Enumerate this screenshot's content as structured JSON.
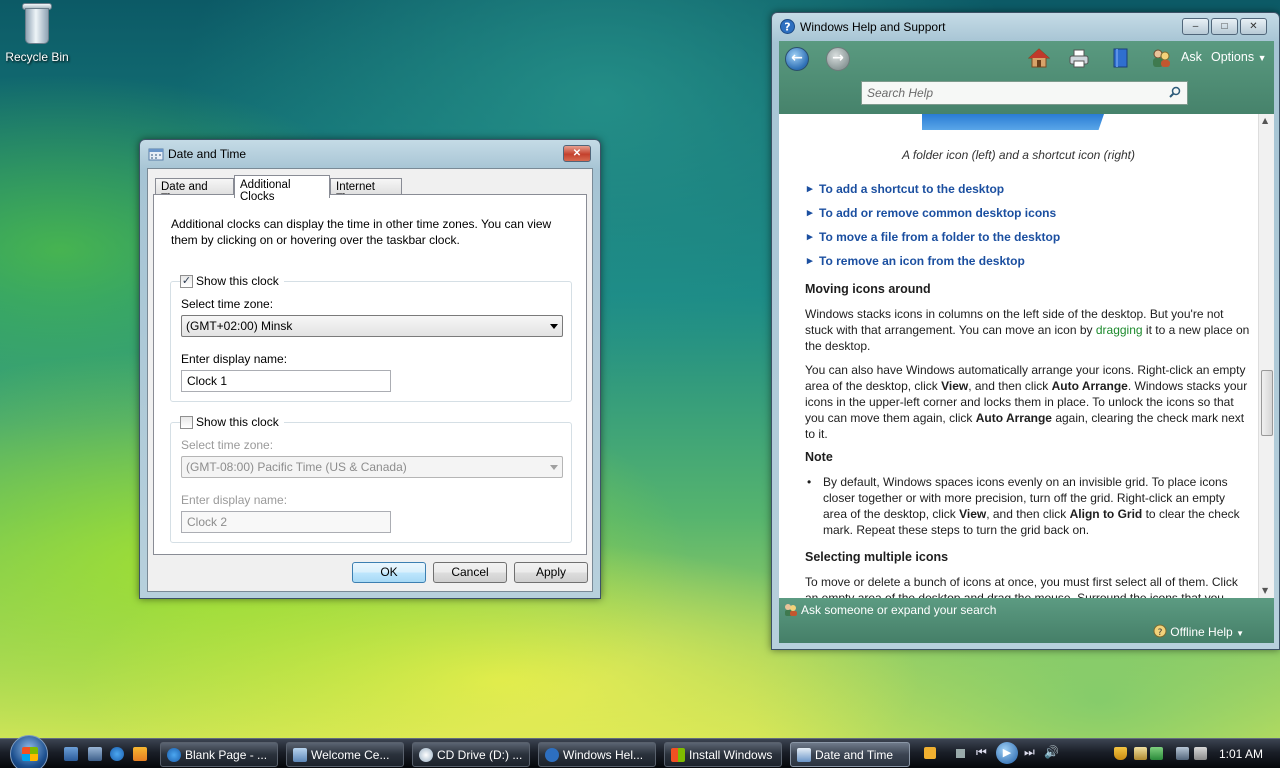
{
  "desktop": {
    "icons": [
      {
        "label": "Recycle Bin",
        "icon": "recycle-bin-icon"
      }
    ]
  },
  "date_time_dialog": {
    "title": "Date and Time",
    "tabs": [
      {
        "label": "Date and Time",
        "active": false
      },
      {
        "label": "Additional Clocks",
        "active": true
      },
      {
        "label": "Internet Time",
        "active": false
      }
    ],
    "description": "Additional clocks can display the time in other time zones. You can view them by clicking on or hovering over the taskbar clock.",
    "clock1": {
      "show_label": "Show this clock",
      "checked": true,
      "zone_label": "Select time zone:",
      "zone_value": "(GMT+02:00) Minsk",
      "name_label": "Enter display name:",
      "name_value": "Clock 1"
    },
    "clock2": {
      "show_label": "Show this clock",
      "checked": false,
      "zone_label": "Select time zone:",
      "zone_value": "(GMT-08:00) Pacific Time (US & Canada)",
      "name_label": "Enter display name:",
      "name_value": "Clock 2"
    },
    "buttons": {
      "ok": "OK",
      "cancel": "Cancel",
      "apply": "Apply"
    }
  },
  "help_window": {
    "title": "Windows Help and Support",
    "toolbar": {
      "ask": "Ask",
      "options": "Options"
    },
    "search_placeholder": "Search Help",
    "caption": "A folder icon (left) and a shortcut icon (right)",
    "links": [
      "To add a shortcut to the desktop",
      "To add or remove common desktop icons",
      "To move a file from a folder to the desktop",
      "To remove an icon from the desktop"
    ],
    "moving_heading": "Moving icons around",
    "moving_p1_a": "Windows stacks icons in columns on the left side of the desktop. But you're not stuck with that arrangement. You can move an icon by ",
    "moving_p1_link": "dragging",
    "moving_p1_b": " it to a new place on the desktop.",
    "moving_p2_a": "You can also have Windows automatically arrange your icons. Right-click an empty area of the desktop, click ",
    "moving_p2_b1": "View",
    "moving_p2_c": ", and then click ",
    "moving_p2_b2": "Auto Arrange",
    "moving_p2_d": ". Windows stacks your icons in the upper-left corner and locks them in place. To unlock the icons so that you can move them again, click ",
    "moving_p2_b3": "Auto Arrange",
    "moving_p2_e": " again, clearing the check mark next to it.",
    "note_heading": "Note",
    "note_a": "By default, Windows spaces icons evenly on an invisible grid. To place icons closer together or with more precision, turn off the grid. Right-click an empty area of the desktop, click ",
    "note_b1": "View",
    "note_c": ", and then click ",
    "note_b2": "Align to Grid",
    "note_d": " to clear the check mark. Repeat these steps to turn the grid back on.",
    "selecting_heading": "Selecting multiple icons",
    "selecting_p": "To move or delete a bunch of icons at once, you must first select all of them. Click an empty area of the desktop and drag the mouse. Surround the icons that you",
    "footer_ask": "Ask someone or expand your search",
    "footer_offline": "Offline Help"
  },
  "taskbar": {
    "tasks": [
      {
        "label": "Blank Page - ...",
        "icon": "ie-icon",
        "active": false
      },
      {
        "label": "Welcome Ce...",
        "icon": "welcome-center-icon",
        "active": false
      },
      {
        "label": "CD Drive (D:) ...",
        "icon": "cd-drive-icon",
        "active": false
      },
      {
        "label": "Windows Hel...",
        "icon": "help-icon",
        "active": false
      },
      {
        "label": "Install Windows",
        "icon": "install-icon",
        "active": false
      },
      {
        "label": "Date and Time",
        "icon": "clock-icon",
        "active": true
      }
    ],
    "clock": "1:01 AM"
  }
}
